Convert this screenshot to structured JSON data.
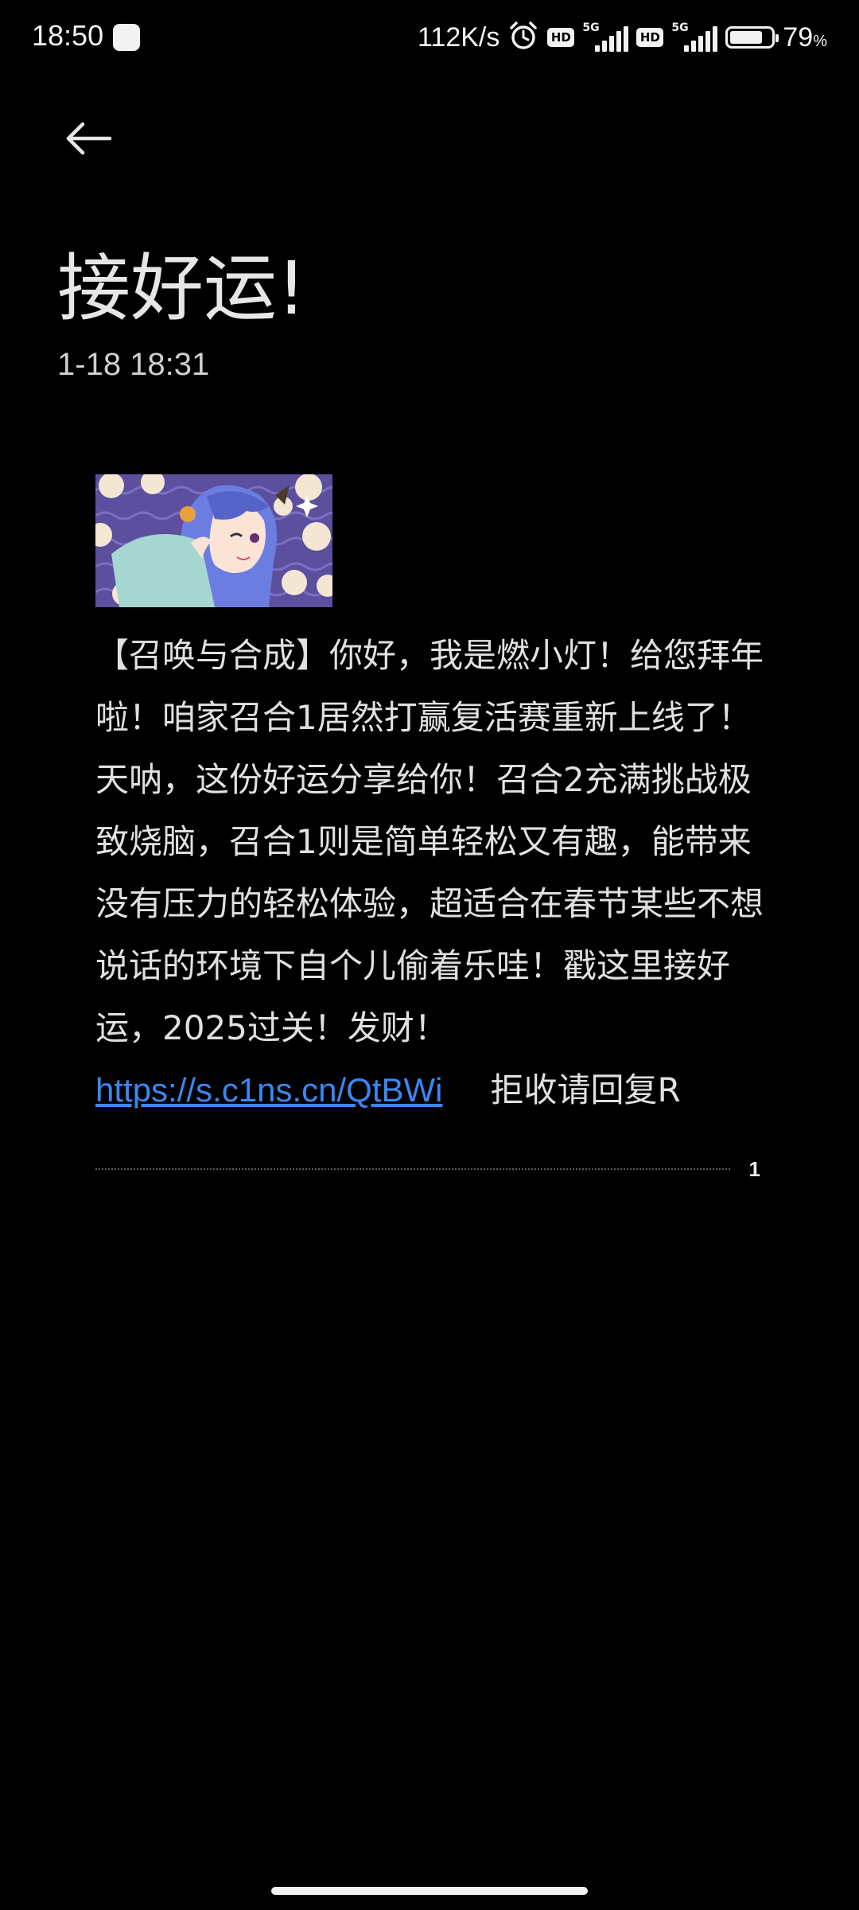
{
  "status_bar": {
    "time": "18:50",
    "net_speed": "112K/s",
    "hd_label": "HD",
    "signal_label": "5G",
    "battery_percent": "79",
    "battery_unit": "%",
    "battery_level": 0.79
  },
  "header": {
    "back_icon": "arrow-left-icon"
  },
  "message": {
    "title": "接好运!",
    "timestamp": "1-18 18:31",
    "image_icon": "anime-character-image",
    "body": "【召唤与合成】你好，我是燃小灯！给您拜年啦！咱家召合1居然打赢复活赛重新上线了！天呐，这份好运分享给你！召合2充满挑战极致烧脑，召合1则是简单轻松又有趣，能带来没有压力的轻松体验，超适合在春节某些不想说话的环境下自个儿偷着乐哇！戳这里接好运，2025过关！发财！",
    "link": "https://s.c1ns.cn/QtBWi",
    "optout": "拒收请回复R"
  },
  "pagination": {
    "page": "1"
  },
  "colors": {
    "background": "#000000",
    "text": "#e0e0e0",
    "link": "#3c87f0"
  }
}
